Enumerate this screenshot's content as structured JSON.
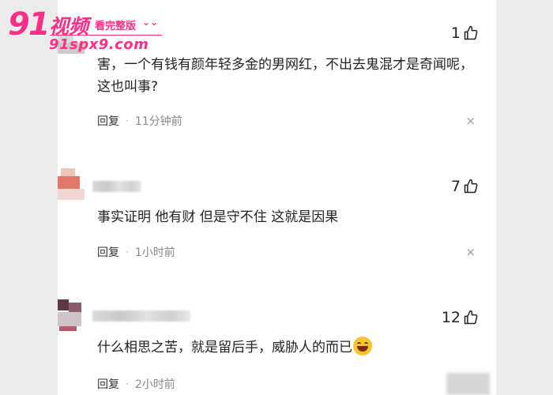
{
  "watermark": {
    "brand_num": "91",
    "brand_text": "视频",
    "tag": "看完整版",
    "url": "91spx9.com"
  },
  "comments": [
    {
      "likes": "1",
      "text": "害，一个有钱有颜年轻多金的男网红，不出去鬼混才是奇闻呢，这也叫事?",
      "reply": "回复",
      "time": "11分钟前"
    },
    {
      "likes": "7",
      "text": "事实证明 他有财 但是守不住 这就是因果",
      "reply": "回复",
      "time": "1小时前"
    },
    {
      "likes": "12",
      "text": "什么相思之苦，就是留后手，威胁人的而已",
      "reply": "回复",
      "time": "2小时前",
      "emoji": "grinning-emoji"
    }
  ],
  "icons": {
    "like": "thumbs-up-icon",
    "close": "close-icon"
  },
  "close_symbol": "×",
  "colors": {
    "watermark": "#ff2f86",
    "panel": "#ffffff",
    "background": "#e9e9e9"
  }
}
